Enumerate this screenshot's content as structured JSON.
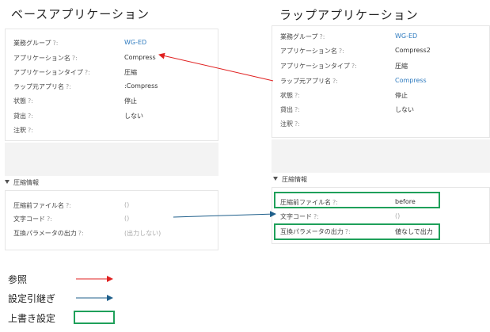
{
  "headings": {
    "base": "ベースアプリケーション",
    "wrap": "ラップアプリケーション"
  },
  "base": {
    "fields": [
      {
        "label": "業務グループ",
        "help": "?:",
        "value": "WG-ED"
      },
      {
        "label": "アプリケーション名",
        "help": "?:",
        "value": "Compress"
      },
      {
        "label": "アプリケーションタイプ",
        "help": "?:",
        "value": "圧縮"
      },
      {
        "label": "ラップ元アプリ名",
        "help": "?:",
        "value": ":Compress"
      },
      {
        "label": "状態",
        "help": "?:",
        "value": "停止"
      },
      {
        "label": "貸出",
        "help": "?:",
        "value": "しない"
      },
      {
        "label": "注釈",
        "help": "?:",
        "value": ""
      }
    ],
    "section": "圧縮情報",
    "compress": [
      {
        "label": "圧縮前ファイル名",
        "help": "?:",
        "value": "()"
      },
      {
        "label": "文字コード",
        "help": "?:",
        "value": "()"
      },
      {
        "label": "互換パラメータの出力",
        "help": "?:",
        "value": "(出力しない)"
      }
    ]
  },
  "wrap": {
    "fields": [
      {
        "label": "業務グループ",
        "help": "?:",
        "value": "WG-ED"
      },
      {
        "label": "アプリケーション名",
        "help": "?:",
        "value": "Compress2"
      },
      {
        "label": "アプリケーションタイプ",
        "help": "?:",
        "value": "圧縮"
      },
      {
        "label": "ラップ元アプリ名",
        "help": "?:",
        "value": "Compress"
      },
      {
        "label": "状態",
        "help": "?:",
        "value": "停止"
      },
      {
        "label": "貸出",
        "help": "?:",
        "value": "しない"
      },
      {
        "label": "注釈",
        "help": "?:",
        "value": ""
      }
    ],
    "section": "圧縮情報",
    "compress": [
      {
        "label": "圧縮前ファイル名",
        "help": "?:",
        "value": "before"
      },
      {
        "label": "文字コード",
        "help": "?:",
        "value": "()"
      },
      {
        "label": "互換パラメータの出力",
        "help": "?:",
        "value": "値なしで出力"
      }
    ]
  },
  "legend": {
    "reference": "参照",
    "inherit": "設定引継ぎ",
    "override": "上書き設定"
  },
  "colors": {
    "reference": "#e02020",
    "inherit": "#1f5f8b",
    "override": "#1fa05a",
    "link": "#2f7bbf"
  }
}
